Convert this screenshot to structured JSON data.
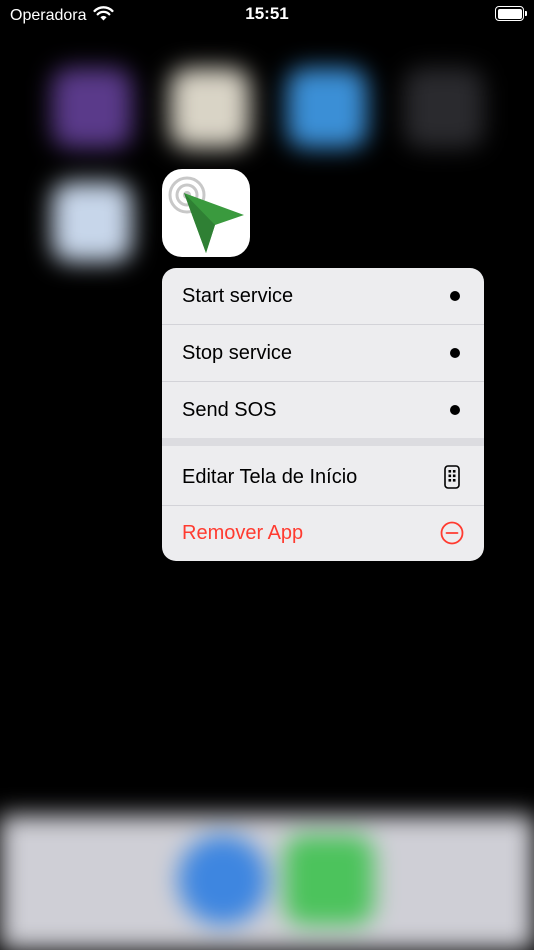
{
  "status_bar": {
    "carrier": "Operadora",
    "time": "15:51"
  },
  "app": {
    "icon_name": "navigation-arrow-icon",
    "accent": "#3a9a3e"
  },
  "context_menu": {
    "shortcuts": [
      {
        "label": "Start service"
      },
      {
        "label": "Stop service"
      },
      {
        "label": "Send SOS"
      }
    ],
    "system_items": [
      {
        "label": "Editar Tela de Início",
        "icon": "home-screen-phone-icon"
      },
      {
        "label": "Remover App",
        "icon": "minus-circle-icon",
        "color": "#ff3b30"
      }
    ]
  }
}
